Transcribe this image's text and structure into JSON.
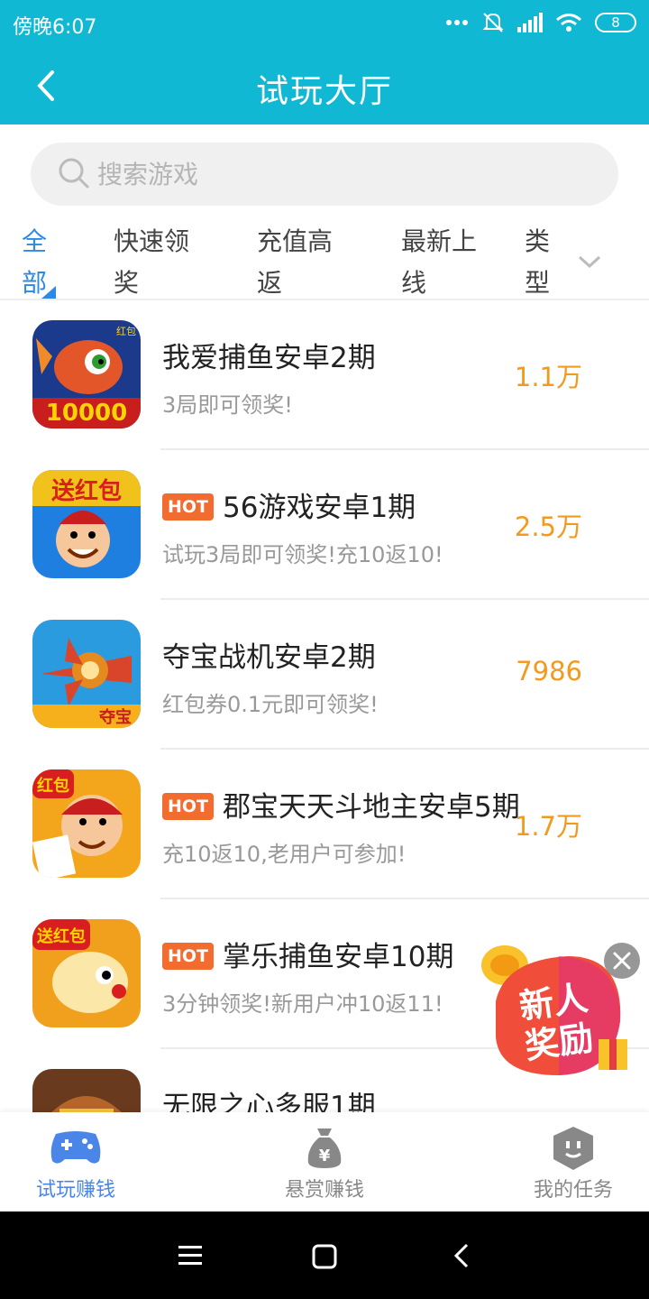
{
  "status_bar": {
    "time": "傍晚6:07",
    "battery": "8"
  },
  "header": {
    "title": "试玩大厅"
  },
  "search": {
    "placeholder": "搜索游戏"
  },
  "tabs": [
    {
      "line1": "全",
      "line2": "部"
    },
    {
      "line1": "快速领",
      "line2": "奖"
    },
    {
      "line1": "充值高",
      "line2": "返"
    },
    {
      "line1": "最新上",
      "line2": "线"
    },
    {
      "line1": "类",
      "line2": "型"
    }
  ],
  "games": [
    {
      "title": "我爱捕鱼安卓2期",
      "hot": false,
      "desc": "3局即可领奖!",
      "reward": "1.1万",
      "icon_text": "10000",
      "badge": "红包"
    },
    {
      "title": "56游戏安卓1期",
      "hot": true,
      "desc": "试玩3局即可领奖!充10返10!",
      "reward": "2.5万",
      "icon_text": "送红包"
    },
    {
      "title": "夺宝战机安卓2期",
      "hot": false,
      "desc": "红包券0.1元即可领奖!",
      "reward": "7986",
      "icon_text": "夺宝"
    },
    {
      "title": "郡宝天天斗地主安卓5期",
      "hot": true,
      "desc": "充10返10,老用户可参加!",
      "reward": "1.7万",
      "icon_text": "红包"
    },
    {
      "title": "掌乐捕鱼安卓10期",
      "hot": true,
      "desc": "3分钟领奖!新用户冲10返11!",
      "reward": "",
      "icon_text": "送红包"
    },
    {
      "title": "无限之心多服1期",
      "hot": false,
      "desc": "",
      "reward": "",
      "icon_text": ""
    }
  ],
  "hot_label": "HOT",
  "promo": {
    "line1": "新人",
    "line2": "奖励"
  },
  "bottom_tabs": [
    {
      "label": "试玩赚钱",
      "icon": "gamepad-icon",
      "active": true
    },
    {
      "label": "悬赏赚钱",
      "icon": "money-bag-icon",
      "active": false
    },
    {
      "label": "我的任务",
      "icon": "shield-face-icon",
      "active": false
    }
  ],
  "colors": {
    "primary": "#11b8d4",
    "active_tab": "#2b8ae6",
    "reward": "#f39a1e",
    "hot": "#f26b2f"
  }
}
